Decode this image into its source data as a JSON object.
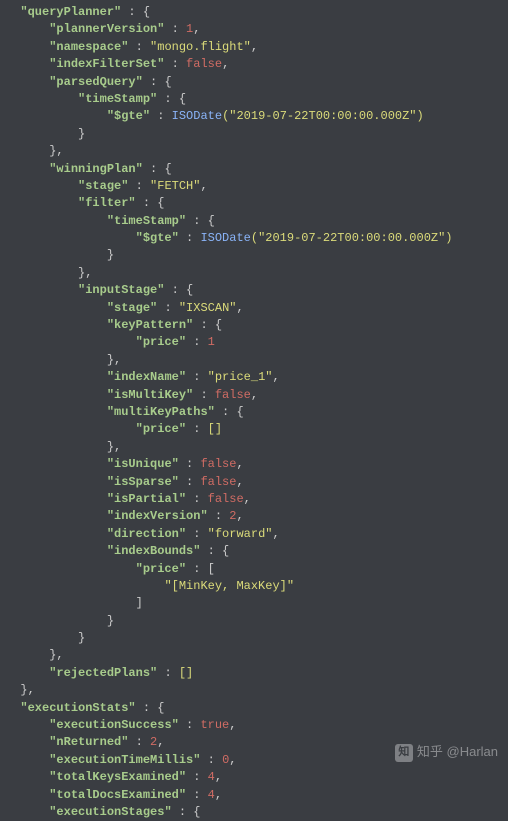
{
  "keys": {
    "queryPlanner": "\"queryPlanner\"",
    "plannerVersion": "\"plannerVersion\"",
    "namespace": "\"namespace\"",
    "indexFilterSet": "\"indexFilterSet\"",
    "parsedQuery": "\"parsedQuery\"",
    "timeStamp": "\"timeStamp\"",
    "gte": "\"$gte\"",
    "winningPlan": "\"winningPlan\"",
    "stage": "\"stage\"",
    "filter": "\"filter\"",
    "inputStage": "\"inputStage\"",
    "keyPattern": "\"keyPattern\"",
    "price": "\"price\"",
    "indexName": "\"indexName\"",
    "isMultiKey": "\"isMultiKey\"",
    "multiKeyPaths": "\"multiKeyPaths\"",
    "isUnique": "\"isUnique\"",
    "isSparse": "\"isSparse\"",
    "isPartial": "\"isPartial\"",
    "indexVersion": "\"indexVersion\"",
    "direction": "\"direction\"",
    "indexBounds": "\"indexBounds\"",
    "rejectedPlans": "\"rejectedPlans\"",
    "executionStats": "\"executionStats\"",
    "executionSuccess": "\"executionSuccess\"",
    "nReturned": "\"nReturned\"",
    "executionTimeMillis": "\"executionTimeMillis\"",
    "totalKeysExamined": "\"totalKeysExamined\"",
    "totalDocsExamined": "\"totalDocsExamined\"",
    "executionStages": "\"executionStages\""
  },
  "vals": {
    "plannerVersion": "1",
    "namespace": "\"mongo.flight\"",
    "false": "false",
    "true": "true",
    "isoFn": "ISODate",
    "isoArg": "(\"2019-07-22T00:00:00.000Z\")",
    "fetch": "\"FETCH\"",
    "ixscan": "\"IXSCAN\"",
    "priceOne": "1",
    "indexName": "\"price_1\"",
    "emptyArr": "[]",
    "indexVersion": "2",
    "forward": "\"forward\"",
    "minmax": "\"[MinKey, MaxKey]\"",
    "nReturned": "2",
    "millis": "0",
    "four": "4"
  },
  "watermark": {
    "logo": "知",
    "text": "知乎 @Harlan"
  }
}
